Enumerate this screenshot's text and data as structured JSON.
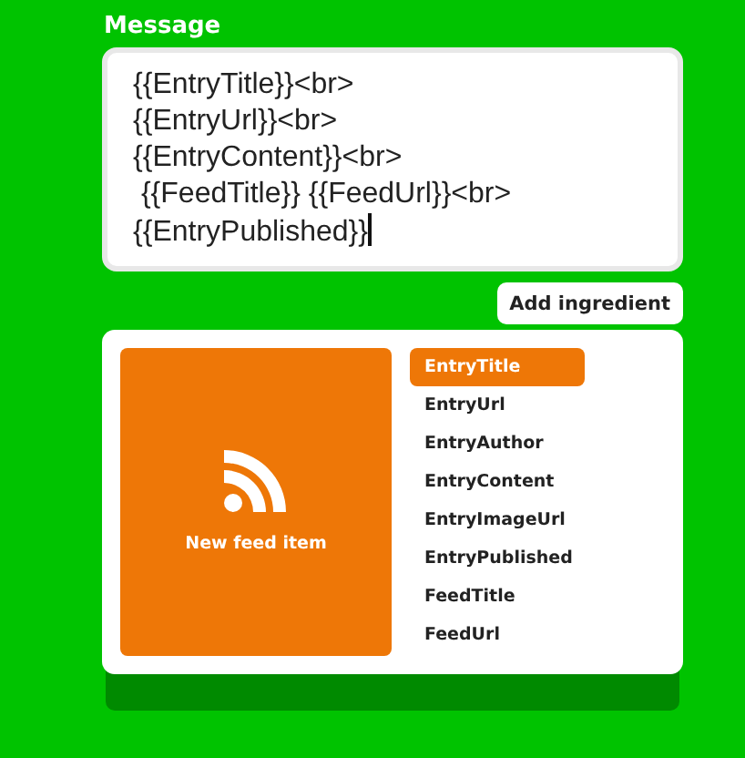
{
  "message": {
    "label": "Message",
    "value": "{{EntryTitle}}<br>\n{{EntryUrl}}<br>\n{{EntryContent}}<br>\n {{FeedTitle}} {{FeedUrl}}<br>\n{{EntryPublished}}"
  },
  "add_button": "Add ingredient",
  "ingredients": {
    "trigger": "New feed item",
    "items": [
      {
        "label": "EntryTitle",
        "selected": true
      },
      {
        "label": "EntryUrl",
        "selected": false
      },
      {
        "label": "EntryAuthor",
        "selected": false
      },
      {
        "label": "EntryContent",
        "selected": false
      },
      {
        "label": "EntryImageUrl",
        "selected": false
      },
      {
        "label": "EntryPublished",
        "selected": false
      },
      {
        "label": "FeedTitle",
        "selected": false
      },
      {
        "label": "FeedUrl",
        "selected": false
      }
    ]
  }
}
